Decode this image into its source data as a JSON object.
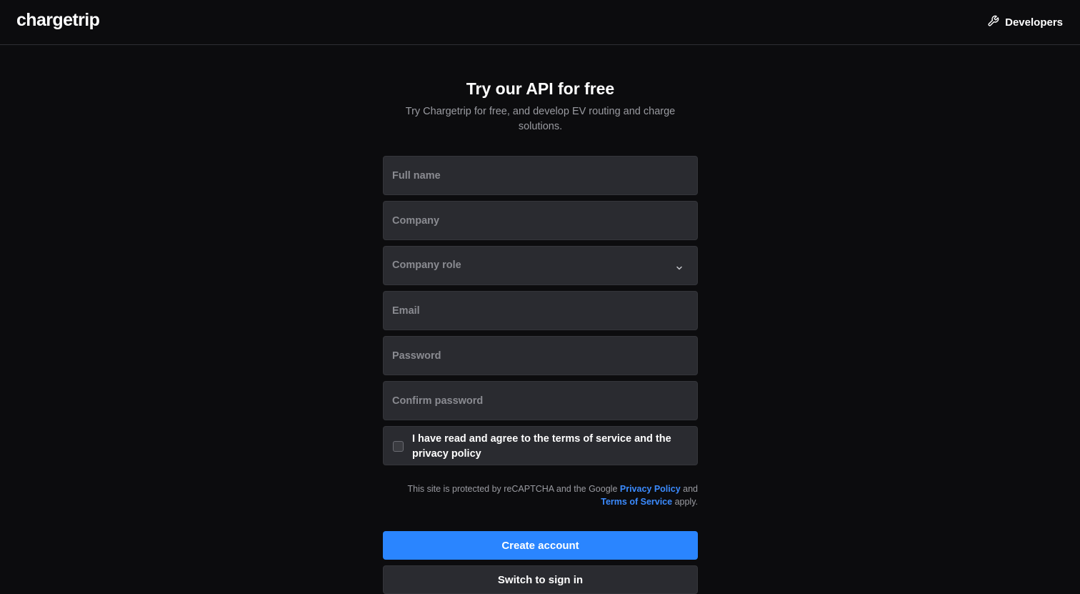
{
  "header": {
    "logo_text": "chargetrip",
    "developers_label": "Developers",
    "developers_icon": "wrench-icon"
  },
  "main": {
    "title": "Try our API for free",
    "subtitle": "Try Chargetrip for free, and develop EV routing and charge solutions."
  },
  "form": {
    "full_name_placeholder": "Full name",
    "company_placeholder": "Company",
    "company_role_placeholder": "Company role",
    "email_placeholder": "Email",
    "password_placeholder": "Password",
    "confirm_password_placeholder": "Confirm password",
    "terms_label": "I have read and agree to the terms of service and the privacy policy",
    "terms_checked": false
  },
  "recaptcha": {
    "prefix": "This site is protected by reCAPTCHA and the Google ",
    "privacy_link": "Privacy Policy",
    "and": " and ",
    "terms_link": "Terms of Service",
    "suffix": " apply."
  },
  "buttons": {
    "create_account": "Create account",
    "switch_to_sign_in": "Switch to sign in"
  },
  "colors": {
    "background": "#0c0c0e",
    "field_background": "#2a2b30",
    "accent": "#2a85ff",
    "link": "#3b8bff"
  }
}
